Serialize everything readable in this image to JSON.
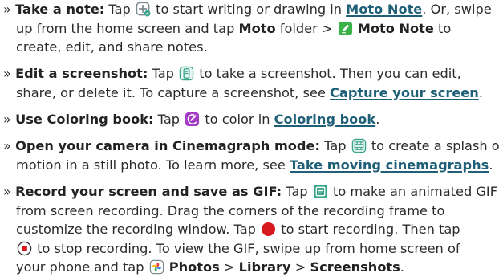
{
  "bullet": "»",
  "items": [
    {
      "l1": {
        "title": "Take a note:",
        "t1": " Tap ",
        "t2": " to start writing or drawing in ",
        "link": "Moto Note",
        "t3": ". Or, swipe"
      },
      "l2": {
        "t1": "up from the home screen and tap ",
        "b1": "Moto",
        "t2": " folder > ",
        "b2": "Moto Note",
        "t3": " to"
      },
      "l3": {
        "t1": "create, edit, and share notes."
      }
    },
    {
      "l1": {
        "title": "Edit a screenshot:",
        "t1": " Tap ",
        "t2": " to take a screenshot. Then you can edit,"
      },
      "l2": {
        "t1": "share, or delete it. To capture a screenshot, see ",
        "link": "Capture your screen",
        "t2": "."
      }
    },
    {
      "l1": {
        "title": "Use Coloring book:",
        "t1": " Tap ",
        "t2": " to color in ",
        "link": "Coloring book",
        "t3": "."
      }
    },
    {
      "l1": {
        "title": "Open your camera in Cinemagraph mode:",
        "t1": " Tap ",
        "t2": " to create a splash of"
      },
      "l2": {
        "t1": "motion in a still photo. To learn more, see ",
        "link": "Take moving cinemagraphs",
        "t2": "."
      }
    },
    {
      "l1": {
        "title": "Record your screen and save as GIF:",
        "t1": " Tap ",
        "t2": " to make an animated GIF"
      },
      "l2": {
        "t1": "from screen recording. Drag the corners of the recording frame to"
      },
      "l3": {
        "t1": "customize the recording window. Tap ",
        "t2": " to start recording. Then tap"
      },
      "l4": {
        "t1": " to stop recording. To view the GIF, swipe up from home screen of"
      },
      "l5": {
        "t1": "your phone and tap ",
        "b1": "Photos",
        "t2": " > ",
        "b2": "Library",
        "t3": " > ",
        "b3": "Screenshots",
        "t4": "."
      }
    }
  ],
  "icons": {
    "note_add": "note-add-icon",
    "moto_note": "moto-note-app-icon",
    "screenshot": "screenshot-icon",
    "coloring": "coloring-book-icon",
    "cinemagraph": "cinemagraph-icon",
    "gif": "gif-record-icon",
    "record": "record-icon",
    "stop": "stop-icon",
    "photos": "photos-icon"
  },
  "colors": {
    "link": "#1f5f78",
    "text": "#2b2b2b",
    "teal": "#3aa48a",
    "record_red": "#d7191f",
    "coloring_purple": "#a33bc4"
  }
}
